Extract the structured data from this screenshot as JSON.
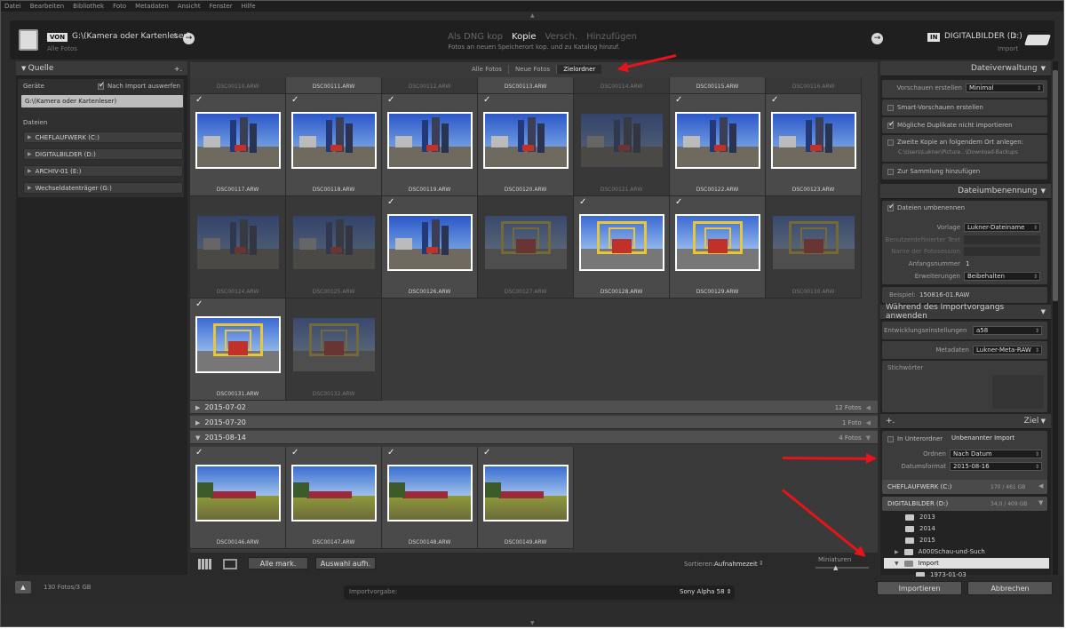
{
  "menu": [
    "Datei",
    "Bearbeiten",
    "Bibliothek",
    "Foto",
    "Metadaten",
    "Ansicht",
    "Fenster",
    "Hilfe"
  ],
  "topbar": {
    "von_badge": "VON",
    "source_path": "G:\\(Kamera oder Kartenleser)",
    "source_sub": "Alle Fotos",
    "modes": [
      "Als DNG kop",
      "Kopie",
      "Versch.",
      "Hinzufügen"
    ],
    "mode_desc": "Fotos an neuen Speicherort kop. und zu Katalog hinzuf.",
    "in_badge": "IN",
    "dest": "DIGITALBILDER (D:)",
    "dest_sub": "Import"
  },
  "left": {
    "title": "Quelle",
    "plus": "+.",
    "devices_label": "Geräte",
    "eject_label": "Nach Import auswerfen",
    "device": "G:\\(Kamera oder Kartenleser)",
    "files_label": "Dateien",
    "drives": [
      "CHEFLAUFWERK (C:)",
      "DIGITALBILDER (D:)",
      "ARCHIV-01 (E:)",
      "Wechseldatenträger (G:)"
    ]
  },
  "center": {
    "tabs": [
      "Alle Fotos",
      "Neue Fotos",
      "Zielordner"
    ],
    "top_row": [
      "DSC00110.ARW",
      "DSC00111.ARW",
      "DSC00112.ARW",
      "DSC00113.ARW",
      "DSC00114.ARW",
      "DSC00115.ARW",
      "DSC00116.ARW"
    ],
    "cells": [
      {
        "name": "DSC00117.ARW",
        "checked": true,
        "dim": false,
        "scene": "tower"
      },
      {
        "name": "DSC00118.ARW",
        "checked": true,
        "dim": false,
        "scene": "tower"
      },
      {
        "name": "DSC00119.ARW",
        "checked": true,
        "dim": false,
        "scene": "tower"
      },
      {
        "name": "DSC00120.ARW",
        "checked": true,
        "dim": false,
        "scene": "tower"
      },
      {
        "name": "DSC00121.ARW",
        "checked": false,
        "dim": true,
        "scene": "tower"
      },
      {
        "name": "DSC00122.ARW",
        "checked": true,
        "dim": false,
        "scene": "tower"
      },
      {
        "name": "DSC00123.ARW",
        "checked": true,
        "dim": false,
        "scene": "tower"
      },
      {
        "name": "DSC00124.ARW",
        "checked": false,
        "dim": true,
        "scene": "tower"
      },
      {
        "name": "DSC00125.ARW",
        "checked": false,
        "dim": true,
        "scene": "tower"
      },
      {
        "name": "DSC00126.ARW",
        "checked": true,
        "dim": false,
        "scene": "tower"
      },
      {
        "name": "DSC00127.ARW",
        "checked": false,
        "dim": true,
        "scene": "bridge"
      },
      {
        "name": "DSC00128.ARW",
        "checked": true,
        "dim": false,
        "scene": "bridge"
      },
      {
        "name": "DSC00129.ARW",
        "checked": true,
        "dim": false,
        "scene": "bridge"
      },
      {
        "name": "DSC00130.ARW",
        "checked": false,
        "dim": true,
        "scene": "bridge"
      },
      {
        "name": "DSC00131.ARW",
        "checked": true,
        "dim": false,
        "scene": "bridge"
      },
      {
        "name": "DSC00132.ARW",
        "checked": false,
        "dim": true,
        "scene": "bridge"
      }
    ],
    "groups": [
      {
        "date": "2015-07-02",
        "count": "12 Fotos"
      },
      {
        "date": "2015-07-20",
        "count": "1 Foto"
      },
      {
        "date": "2015-08-14",
        "count": "4 Fotos"
      }
    ],
    "aug_cells": [
      {
        "name": "DSC00146.ARW",
        "checked": true,
        "dim": false,
        "scene": "field"
      },
      {
        "name": "DSC00147.ARW",
        "checked": true,
        "dim": false,
        "scene": "field"
      },
      {
        "name": "DSC00148.ARW",
        "checked": true,
        "dim": false,
        "scene": "field"
      },
      {
        "name": "DSC00149.ARW",
        "checked": true,
        "dim": false,
        "scene": "field"
      }
    ],
    "toolbar": {
      "check_all": "Alle mark.",
      "uncheck_all": "Auswahl aufh.",
      "sort_label": "Sortieren:",
      "sort_value": "Aufnahmezeit",
      "thumbs_label": "Miniaturen"
    }
  },
  "right": {
    "file_handling": {
      "title": "Dateiverwaltung",
      "previews_label": "Vorschauen erstellen",
      "previews_value": "Minimal",
      "smart": "Smart-Vorschauen erstellen",
      "nodup": "Mögliche Duplikate nicht importieren",
      "second_copy": "Zweite Kopie an folgendem Ort anlegen:",
      "second_path": "C:\\Users\\Lukner\\Picture...\\Download-Backups",
      "collection": "Zur Sammlung hinzufügen"
    },
    "rename": {
      "title": "Dateiumbenennung",
      "rename_files": "Dateien umbenennen",
      "template_label": "Vorlage",
      "template_value": "Lukner-Dateiname",
      "custom_text": "Benutzerdefinierter Text",
      "session_name": "Name der Fotosession",
      "start_label": "Anfangsnummer",
      "start_value": "1",
      "ext_label": "Erweiterungen",
      "ext_value": "Beibehalten",
      "sample_label": "Beispiel:",
      "sample_value": "150816-01.RAW"
    },
    "apply": {
      "title": "Während des Importvorgangs anwenden",
      "dev_label": "Entwicklungseinstellungen",
      "dev_value": "a58",
      "meta_label": "Metadaten",
      "meta_value": "Lukner-Meta-RAW",
      "keywords": "Stichwörter"
    },
    "dest": {
      "title": "Ziel",
      "plus": "+.",
      "subfolder": "In Unterordner",
      "subfolder_value": "Unbenannter Import",
      "organize_label": "Ordnen",
      "organize_value": "Nach Datum",
      "date_label": "Datumsformat",
      "date_value": "2015-08-16",
      "vol1": "CHEFLAUFWERK (C:)",
      "vol1_size": "170 / 461 GB",
      "vol2": "DIGITALBILDER (D:)",
      "vol2_size": "34,0 / 409 GB",
      "folders": [
        "2013",
        "2014",
        "2015",
        "A000Schau-und-Such",
        "Import",
        "1973-01-03"
      ]
    }
  },
  "bottom": {
    "count": "130 Fotos/3 GB",
    "preset_label": "Importvorgabe:",
    "preset_value": "Sony Alpha 58 ⇕",
    "import": "Importieren",
    "cancel": "Abbrechen"
  },
  "colors": {
    "accent": "#e8141a",
    "panel": "#3c3c3c",
    "bg": "#2c2c2c"
  }
}
